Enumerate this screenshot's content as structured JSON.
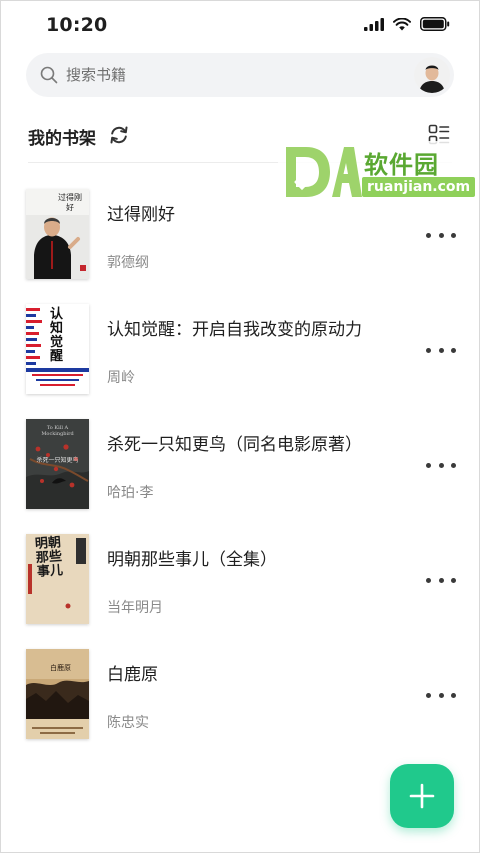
{
  "status_bar": {
    "time": "10:20"
  },
  "search": {
    "placeholder": "搜索书籍"
  },
  "shelf": {
    "title": "我的书架"
  },
  "watermark": {
    "name": "软件园",
    "url": "ruanjian.com"
  },
  "books": [
    {
      "title": "过得刚好",
      "author": "郭德纲",
      "cover_text": "过得刚好"
    },
    {
      "title": "认知觉醒：开启自我改变的原动力",
      "author": "周岭",
      "cover_text": "认知觉醒"
    },
    {
      "title": "杀死一只知更鸟（同名电影原著）",
      "author": "哈珀·李",
      "cover_text": "杀死一只知更鸟",
      "cover_en": "To Kill A Mockingbird"
    },
    {
      "title": "明朝那些事儿（全集）",
      "author": "当年明月",
      "cover_text": "明朝那些事儿"
    },
    {
      "title": "白鹿原",
      "author": "陈忠实",
      "cover_text": "白鹿原"
    }
  ],
  "colors": {
    "accent": "#20c98c",
    "search_bg": "#f2f3f5",
    "secondary_text": "#8a8a8a"
  },
  "icons": [
    "search-icon",
    "refresh-icon",
    "layout-toggle-icon",
    "more-icon",
    "plus-icon",
    "signal-icon",
    "wifi-icon",
    "battery-icon"
  ]
}
